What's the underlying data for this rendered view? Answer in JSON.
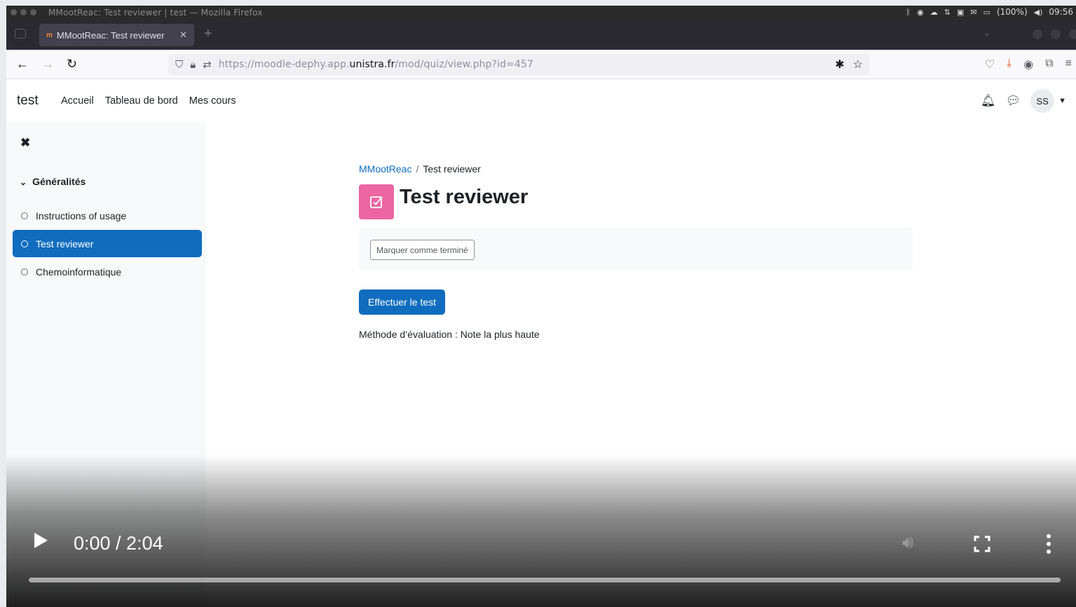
{
  "window": {
    "title": "MMootReac: Test reviewer | test — Mozilla Firefox",
    "tray": {
      "battery": "(100%)",
      "clock": "09:56"
    }
  },
  "browser": {
    "tab_label": "MMootReac: Test reviewer",
    "url_prefix": "https://moodle-dephy.app.",
    "url_domain": "unistra.fr",
    "url_path": "/mod/quiz/view.php?id=457"
  },
  "moodle": {
    "brand": "test",
    "nav": [
      "Accueil",
      "Tableau de bord",
      "Mes cours"
    ],
    "user_initials": "SS"
  },
  "sidebar": {
    "section": "Généralités",
    "items": [
      {
        "label": "Instructions of usage"
      },
      {
        "label": "Test reviewer"
      },
      {
        "label": "Chemoinformatique"
      }
    ]
  },
  "main": {
    "breadcrumb": [
      "MMootReac",
      "Test reviewer"
    ],
    "title": "Test reviewer",
    "mark_done": "Marquer comme terminé",
    "attempt": "Effectuer le test",
    "grading": "Méthode d’évaluation : Note la plus haute"
  },
  "video": {
    "time": "0:00 / 2:04",
    "progress_fraction": 0.0
  }
}
